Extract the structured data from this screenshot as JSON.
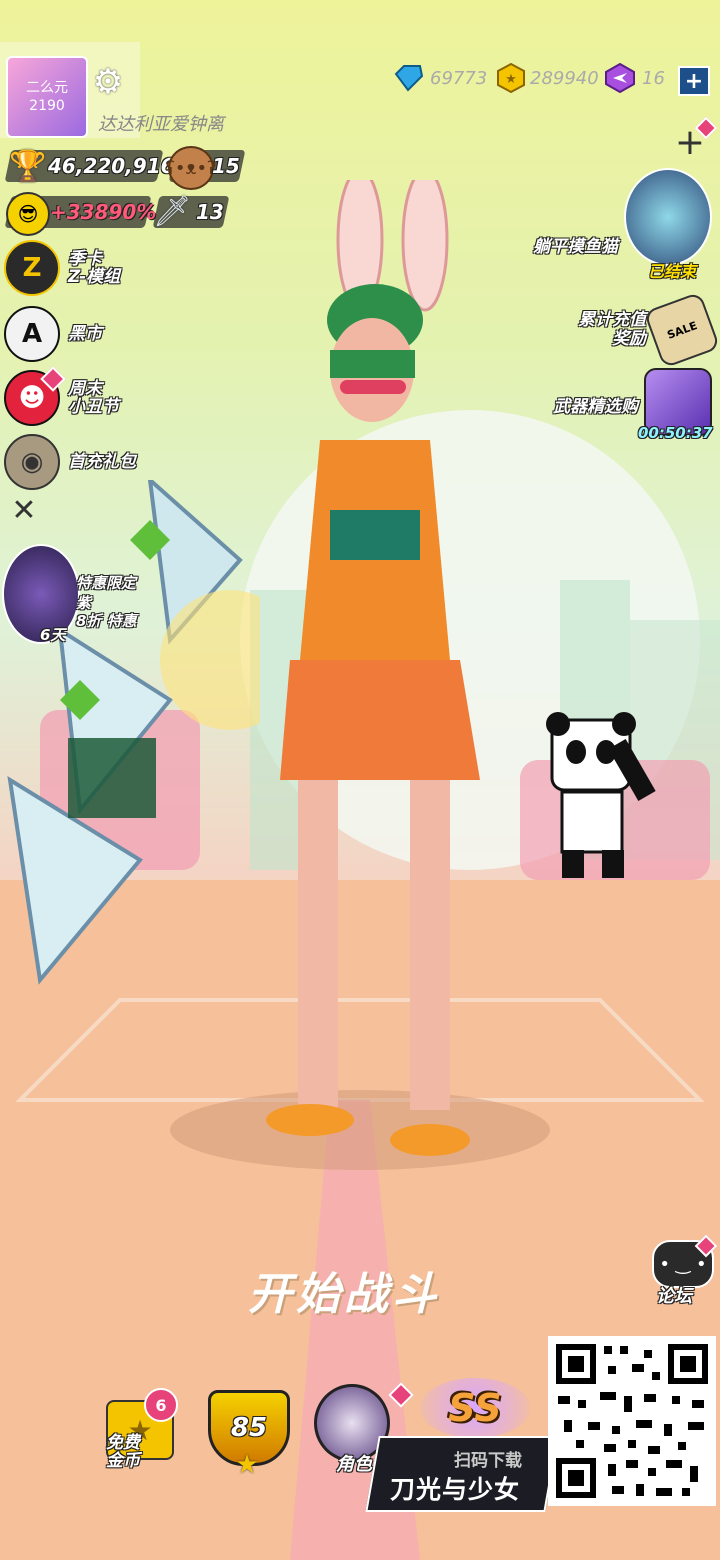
{
  "player": {
    "name": "达达利亚爱钟离",
    "avatar_text": "二么元\n2190",
    "trophies": "46,220,916",
    "bears": "15",
    "boost": "+33890%",
    "weapons": "13"
  },
  "currency": {
    "diamonds": "69773",
    "gold": "289940",
    "purple": "16"
  },
  "left_menu": [
    {
      "label": "季卡\nZ-模组",
      "icon": "z-mod-icon",
      "glyph": "Z"
    },
    {
      "label": "黑市",
      "icon": "spade-ace-icon",
      "glyph": "A"
    },
    {
      "label": "周末\n小丑节",
      "icon": "clown-icon",
      "glyph": "☻"
    },
    {
      "label": "首充礼包",
      "icon": "bag-icon",
      "glyph": "◉"
    }
  ],
  "promo": {
    "line1": "特惠限定",
    "line2": "紫",
    "line3": "8折 特惠",
    "days": "6天"
  },
  "right_menu": [
    {
      "label": "躺平摸鱼猫",
      "badge": "已结束"
    },
    {
      "label": "累计充值\n奖励",
      "badge": "SALE"
    },
    {
      "label": "武器精选购",
      "badge": "00:50:37"
    }
  ],
  "start_label": "开始战斗",
  "forum_label": "论坛",
  "bottom": {
    "free_coins": "免费\n金币",
    "free_badge": "6",
    "level": "85",
    "role": "角色",
    "rank": "SS"
  },
  "qr": {
    "line1": "扫码下载",
    "line2": "刀光与少女"
  },
  "colors": {
    "accent": "#e8427a",
    "gold": "#f5c400",
    "diamond": "#2fa7e6",
    "purple": "#a84fe0"
  }
}
